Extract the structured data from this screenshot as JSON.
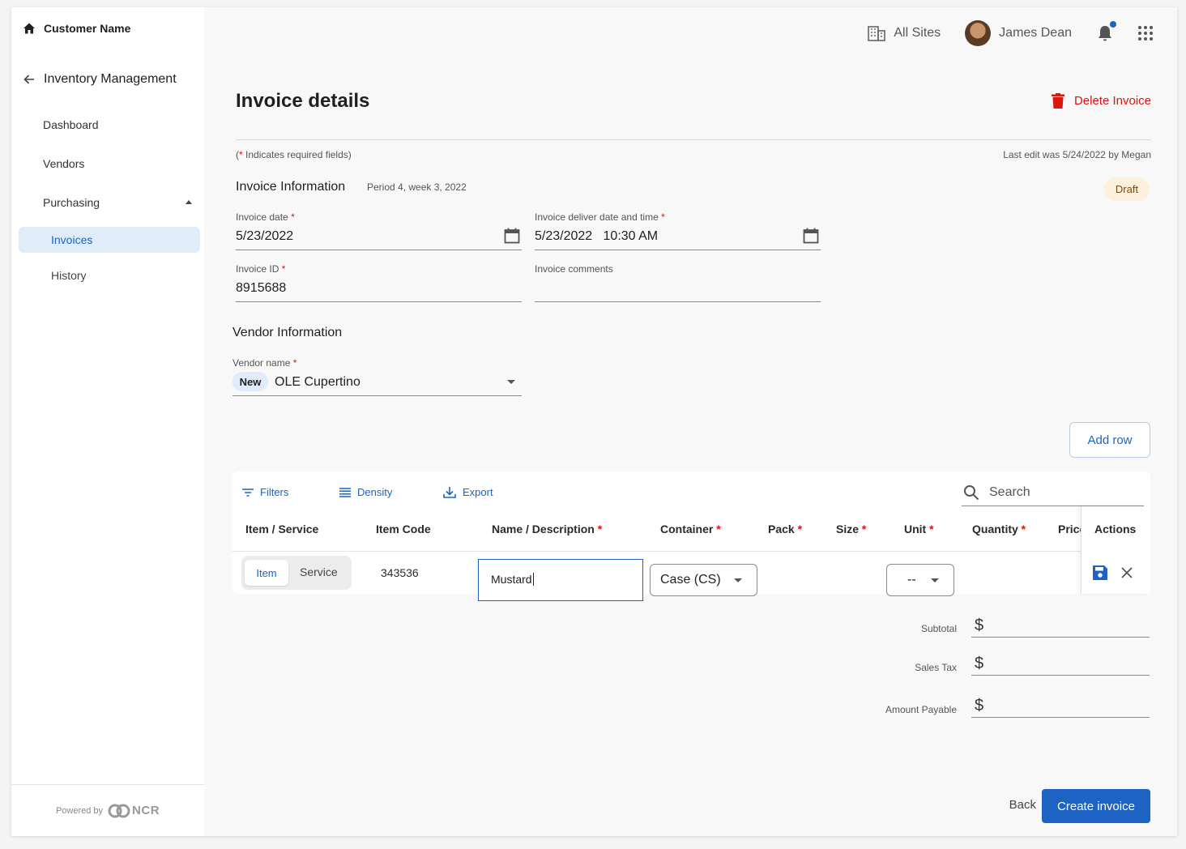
{
  "sidebar": {
    "customer_name": "Customer Name",
    "module_title": "Inventory Management",
    "items": [
      {
        "label": "Dashboard"
      },
      {
        "label": "Vendors"
      },
      {
        "label": "Purchasing"
      }
    ],
    "sub_items": [
      {
        "label": "Invoices",
        "active": true
      },
      {
        "label": "History",
        "active": false
      }
    ],
    "powered_by": "Powered by",
    "brand": "NCR"
  },
  "topbar": {
    "sites_label": "All Sites",
    "user_name": "James Dean",
    "notification_dot": true,
    "icons": [
      "building-icon",
      "avatar",
      "bell-icon",
      "apps-grid-icon"
    ]
  },
  "page": {
    "title": "Invoice details",
    "delete_label": "Delete Invoice",
    "required_note_open": "(",
    "required_note_star": "*",
    "required_note_text": " Indicates required fields)",
    "last_edit": "Last edit was 5/24/2022 by Megan"
  },
  "invoice_info": {
    "heading": "Invoice Information",
    "period": "Period 4, week 3, 2022",
    "status": "Draft",
    "invoice_date_label": "Invoice date",
    "invoice_date_value": "5/23/2022",
    "deliver_label": "Invoice deliver date and time",
    "deliver_value": "5/23/2022   10:30 AM",
    "invoice_id_label": "Invoice ID",
    "invoice_id_value": "8915688",
    "comments_label": "Invoice comments",
    "comments_value": "",
    "required_star": "*"
  },
  "vendor_info": {
    "heading": "Vendor Information",
    "vendor_label": "Vendor name",
    "vendor_chip": "New",
    "vendor_value": "OLE Cupertino"
  },
  "table": {
    "add_row_label": "Add row",
    "toolbar": {
      "filters": "Filters",
      "density": "Density",
      "export": "Export",
      "search_placeholder": "Search"
    },
    "columns": [
      {
        "label": "Item / Service",
        "required": false
      },
      {
        "label": "Item Code",
        "required": false
      },
      {
        "label": "Name / Description",
        "required": true
      },
      {
        "label": "Container",
        "required": true
      },
      {
        "label": "Pack",
        "required": true
      },
      {
        "label": "Size",
        "required": true
      },
      {
        "label": "Unit",
        "required": true
      },
      {
        "label": "Quantity",
        "required": true
      },
      {
        "label": "Price",
        "required": false
      },
      {
        "label": "Actions",
        "required": false
      }
    ],
    "row": {
      "toggle_item": "Item",
      "toggle_service": "Service",
      "toggle_selected": "Item",
      "item_code": "343536",
      "name": "Mustard",
      "container": "Case (CS)",
      "unit": "--"
    }
  },
  "totals": {
    "currency": "$",
    "subtotal_label": "Subtotal",
    "sales_tax_label": "Sales Tax",
    "amount_payable_label": "Amount Payable"
  },
  "footer": {
    "back_label": "Back",
    "create_label": "Create invoice"
  },
  "colors": {
    "accent": "#1c63c4",
    "danger": "#d9160f",
    "draft_bg": "#fdf1de"
  }
}
